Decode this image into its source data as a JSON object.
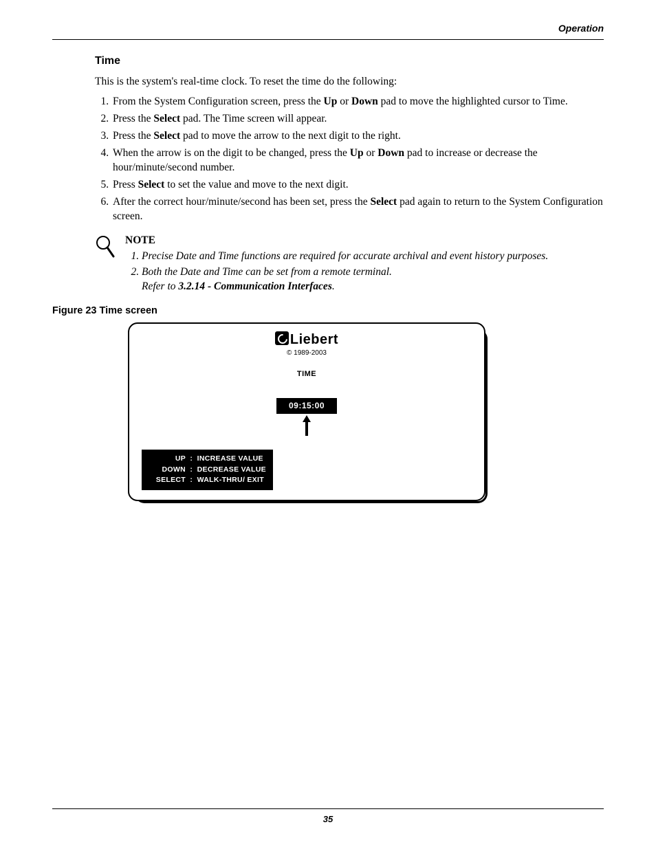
{
  "header": {
    "running": "Operation"
  },
  "section": {
    "title": "Time",
    "intro_before": "This is the system's real-time clock. To reset the time do the following:"
  },
  "steps": {
    "s1_a": "From the System Configuration screen, press the ",
    "s1_up": "Up",
    "s1_b": " or ",
    "s1_down": "Down",
    "s1_c": " pad to move the highlighted cursor to Time.",
    "s2_a": "Press the ",
    "s2_sel": "Select",
    "s2_b": " pad. The Time screen will appear.",
    "s3_a": "Press the ",
    "s3_sel": "Select",
    "s3_b": " pad to move the arrow to the next digit to the right.",
    "s4_a": "When the arrow is on the digit to be changed, press the ",
    "s4_up": "Up",
    "s4_b": " or ",
    "s4_down": "Down",
    "s4_c": " pad to increase or decrease the hour/minute/second number.",
    "s5_a": "Press ",
    "s5_sel": "Select",
    "s5_b": " to set the value and move to the next digit.",
    "s6_a": "After the correct hour/minute/second has been set, press the ",
    "s6_sel": "Select",
    "s6_b": " pad again to return to the System Configuration screen."
  },
  "note": {
    "heading": "NOTE",
    "n1": "Precise Date and Time functions are required for accurate archival and event history purposes.",
    "n2_a": "Both the Date and Time can be set from a remote terminal.",
    "n2_b": "Refer to ",
    "n2_ref": "3.2.14 - Communication Interfaces",
    "n2_c": "."
  },
  "figure": {
    "caption": "Figure 23   Time screen",
    "brand": "Liebert",
    "copyright": "© 1989-2003",
    "screen_title": "TIME",
    "time_value": "09:15:00",
    "keys": {
      "up_k": "UP",
      "up_v": "INCREASE VALUE",
      "down_k": "DOWN",
      "down_v": "DECREASE VALUE",
      "sel_k": "SELECT",
      "sel_v": "WALK-THRU/ EXIT"
    }
  },
  "page_number": "35"
}
